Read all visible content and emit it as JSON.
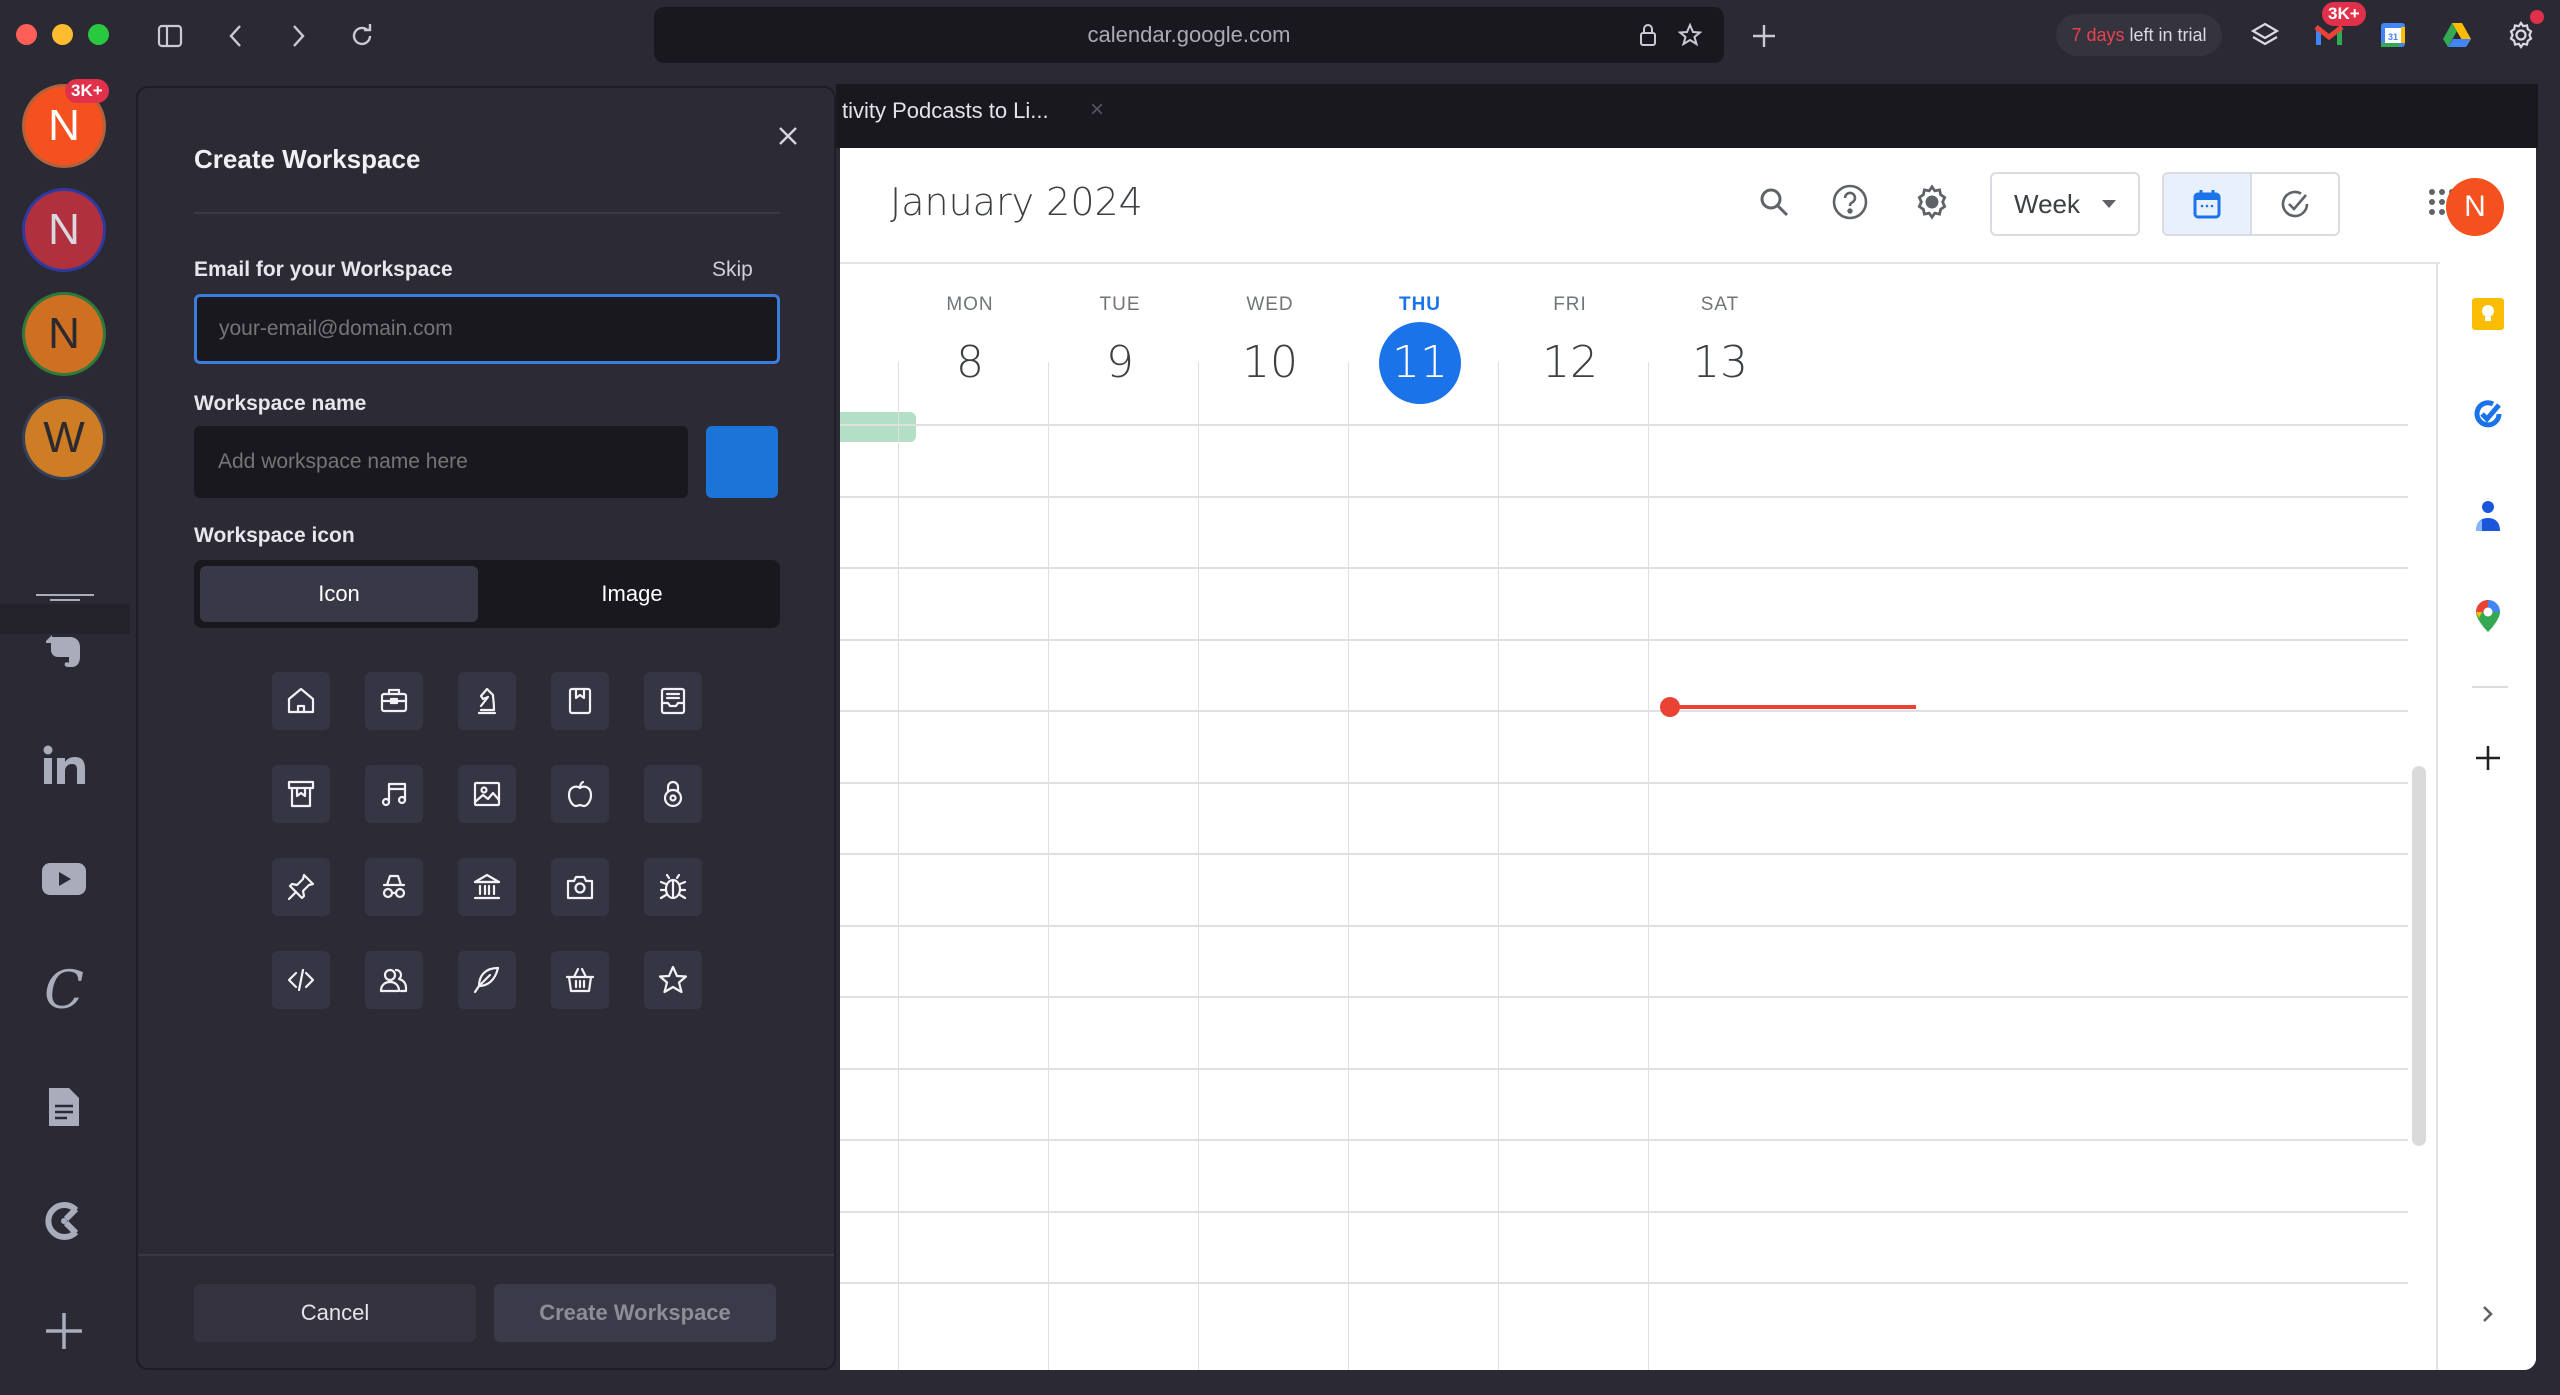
{
  "browser": {
    "url": "calendar.google.com",
    "trial": {
      "days": "7 days",
      "rest": "left in trial"
    },
    "gmail_badge": "3K+",
    "icons": [
      "sidebar-toggle-icon",
      "back-icon",
      "forward-icon",
      "reload-icon",
      "lock-icon",
      "star-icon",
      "new-tab-icon",
      "layers-icon",
      "gmail-icon",
      "google-calendar-icon",
      "google-drive-icon",
      "settings-icon"
    ]
  },
  "sidebar": {
    "workspaces": [
      {
        "letter": "N",
        "badge": "3K+",
        "bg": "#f4511e",
        "ring": "#b0623c",
        "fg": "#ffffff"
      },
      {
        "letter": "N",
        "badge": "",
        "bg": "#b0303e",
        "ring": "#2f3aa0",
        "fg": "#d8d8de"
      },
      {
        "letter": "N",
        "badge": "",
        "bg": "#cf6f22",
        "ring": "#2f7a3a",
        "fg": "#2b2a30"
      },
      {
        "letter": "W",
        "badge": "",
        "bg": "#cf7d25",
        "ring": "#34405a",
        "fg": "#2b2a30"
      }
    ],
    "apps": [
      "evernote-icon",
      "linkedin-icon",
      "youtube-icon",
      "coda-icon",
      "google-docs-icon",
      "clockify-icon",
      "add-app-icon"
    ]
  },
  "modal": {
    "title": "Create Workspace",
    "email_label": "Email for your Workspace",
    "skip": "Skip",
    "email_placeholder": "your-email@domain.com",
    "email_value": "",
    "name_label": "Workspace name",
    "name_placeholder": "Add workspace name here",
    "name_value": "",
    "color": "#1b74d8",
    "icon_label": "Workspace icon",
    "tabs": [
      {
        "label": "Icon",
        "active": true
      },
      {
        "label": "Image",
        "active": false
      }
    ],
    "icons": [
      "home",
      "briefcase",
      "chess-knight",
      "bookmark-book",
      "archive-inbox",
      "store",
      "music-note",
      "image",
      "apple",
      "lock-dial",
      "pin",
      "incognito",
      "bank",
      "camera",
      "bug",
      "code",
      "users",
      "feather",
      "basket",
      "star"
    ],
    "cancel": "Cancel",
    "create": "Create Workspace"
  },
  "tab": {
    "title": "tivity Podcasts to Li...",
    "close": "×"
  },
  "calendar": {
    "title": "January 2024",
    "view": "Week",
    "days": [
      {
        "name": "MON",
        "num": "8",
        "today": false
      },
      {
        "name": "TUE",
        "num": "9",
        "today": false
      },
      {
        "name": "WED",
        "num": "10",
        "today": false
      },
      {
        "name": "THU",
        "num": "11",
        "today": true
      },
      {
        "name": "FRI",
        "num": "12",
        "today": false
      },
      {
        "name": "SAT",
        "num": "13",
        "today": false
      }
    ],
    "user_initial": "N",
    "side_apps": [
      "google-keep-icon",
      "google-tasks-icon",
      "google-contacts-icon",
      "google-maps-icon",
      "add-addon-icon",
      "expand-panel-icon"
    ],
    "accent": "#1a73e8",
    "now_color": "#ea4335"
  }
}
